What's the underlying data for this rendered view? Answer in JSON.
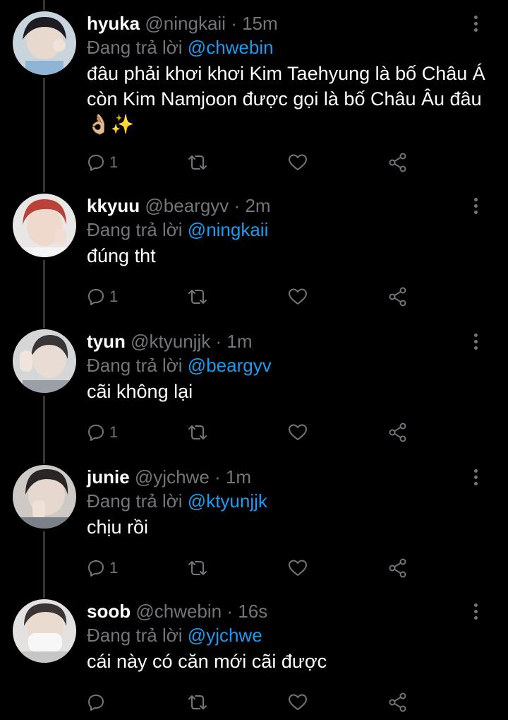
{
  "colors": {
    "background": "#000000",
    "text_primary": "#ffffff",
    "text_secondary": "#71767b",
    "accent": "#1d9bf0",
    "thread_line": "#333639"
  },
  "icons": {
    "reply": "reply-icon",
    "retweet": "retweet-icon",
    "like": "heart-icon",
    "share": "share-icon",
    "more": "more-vertical-icon"
  },
  "tweets": [
    {
      "name": "hyuka",
      "handle": "@ningkaii",
      "separator": "·",
      "time": "15m",
      "reply_prefix": "Đang trả lời",
      "reply_to": "@chwebin",
      "text": "đâu phải khơi khơi Kim Taehyung là bố Châu Á còn Kim Namjoon được gọi là bố Châu Âu đâu 👌🏼✨",
      "reply_count": "1"
    },
    {
      "name": "kkyuu",
      "handle": "@beargyv",
      "separator": "·",
      "time": "2m",
      "reply_prefix": "Đang trả lời",
      "reply_to": "@ningkaii",
      "text": "đúng tht",
      "reply_count": "1"
    },
    {
      "name": "tyun",
      "handle": "@ktyunjjk",
      "separator": "·",
      "time": "1m",
      "reply_prefix": "Đang trả lời",
      "reply_to": "@beargyv",
      "text": "cãi không lại",
      "reply_count": "1"
    },
    {
      "name": "junie",
      "handle": "@yjchwe",
      "separator": "·",
      "time": "1m",
      "reply_prefix": "Đang trả lời",
      "reply_to": "@ktyunjjk",
      "text": "chịu rồi",
      "reply_count": "1"
    },
    {
      "name": "soob",
      "handle": "@chwebin",
      "separator": "·",
      "time": "16s",
      "reply_prefix": "Đang trả lời",
      "reply_to": "@yjchwe",
      "text": "cái này có căn mới cãi được",
      "reply_count": ""
    }
  ]
}
